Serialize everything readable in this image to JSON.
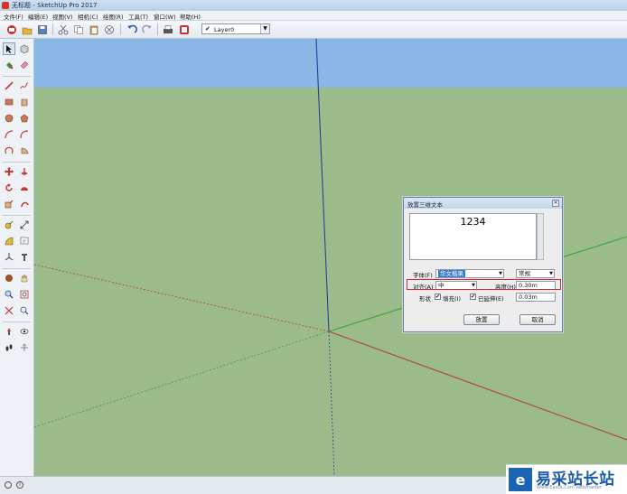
{
  "window": {
    "title": "无标题 - SketchUp Pro 2017"
  },
  "menu": [
    "文件(F)",
    "编辑(E)",
    "视图(V)",
    "相机(C)",
    "绘图(R)",
    "工具(T)",
    "窗口(W)",
    "帮助(H)"
  ],
  "toolbar": {
    "layer_value": "Layer0",
    "layer_check": "✔"
  },
  "dialog": {
    "title": "放置三维文本",
    "text_value": "1234",
    "font_label": "字体(F)",
    "font_value": "华文楷果",
    "style_value": "常规",
    "align_label": "对齐(A)",
    "align_value": "中",
    "height_label": "高度(H)",
    "height_value": "0.30m",
    "form_label": "形状",
    "fill_label": "填充(I)",
    "extrude_label": "已延伸(E)",
    "extrude_value": "0.03m",
    "place_button": "放置",
    "cancel_button": "取消"
  },
  "watermark": {
    "brand": "易采站长站",
    "url": "Www.Easck.Com Webmaster"
  },
  "colors": {
    "sky": "#89b7e6",
    "ground": "#9bbb8b",
    "axis_red": "#b4413a",
    "axis_green": "#3aa23a",
    "axis_blue": "#2b3f9a",
    "highlight": "#d9262b",
    "brand_blue": "#1b63b3"
  }
}
